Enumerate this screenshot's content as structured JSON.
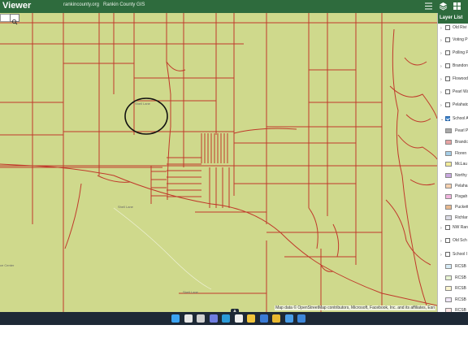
{
  "header": {
    "title": "Viewer",
    "links": [
      "rankincounty.org",
      "Rankin County GIS"
    ]
  },
  "map": {
    "attribution": "Map data © OpenStreetMap contributors, Microsoft, Facebook, Inc. and its affiliates, Esri",
    "road_labels": [
      "Shell Lane",
      "Shell Lane",
      "Shell Lane"
    ],
    "place_label": "ce Center",
    "base_color": "#cfd98c",
    "parcel_color": "#c0392b"
  },
  "layer_panel": {
    "title": "Layer List",
    "layers": [
      {
        "label": "Old Rivi",
        "checked": false
      },
      {
        "label": "Voting P",
        "checked": false
      },
      {
        "label": "Polling P",
        "checked": false
      },
      {
        "label": "Brandon",
        "checked": false
      },
      {
        "label": "Flowood",
        "checked": false
      },
      {
        "label": "Pearl Wa",
        "checked": false
      },
      {
        "label": "Pelahatc",
        "checked": false
      },
      {
        "label": "School A",
        "checked": true
      }
    ],
    "legend": [
      {
        "label": "Pearl P",
        "color": "#a9a9a9"
      },
      {
        "label": "Brandc",
        "color": "#e7a3a3"
      },
      {
        "label": "Floren",
        "color": "#a6cfe8"
      },
      {
        "label": "McLau",
        "color": "#f3ec9a"
      },
      {
        "label": "Northy",
        "color": "#c9a8e0"
      },
      {
        "label": "Pelaha",
        "color": "#f6d1b0"
      },
      {
        "label": "Pisgah",
        "color": "#f2b5df"
      },
      {
        "label": "Puckett",
        "color": "#e8b98f"
      },
      {
        "label": "Richlar",
        "color": "#dcdce6"
      }
    ],
    "more_layers": [
      {
        "label": "NW Ran",
        "checked": false
      },
      {
        "label": "Old Sch",
        "checked": false
      },
      {
        "label": "School I",
        "checked": false
      }
    ],
    "rcsb": [
      {
        "label": "RCSB",
        "color": "#d7ecf7"
      },
      {
        "label": "RCSB",
        "color": "#e8f5d4"
      },
      {
        "label": "RCSB",
        "color": "#fbf5cf"
      },
      {
        "label": "RCSB",
        "color": "#f0e6f7"
      },
      {
        "label": "RCSB",
        "color": "#fde4e4"
      }
    ]
  },
  "taskbar": {
    "icons": [
      {
        "name": "windows-start-icon",
        "color": "#3ba3f2"
      },
      {
        "name": "search-icon",
        "color": "#e7e7e7"
      },
      {
        "name": "task-view-icon",
        "color": "#d0d0d0"
      },
      {
        "name": "chat-icon",
        "color": "#6f7de0"
      },
      {
        "name": "edge-icon",
        "color": "#2b9ad8"
      },
      {
        "name": "photos-icon",
        "color": "#f0f0f0"
      },
      {
        "name": "file-explorer-icon",
        "color": "#f2c53c"
      },
      {
        "name": "store-icon",
        "color": "#3a7bd5"
      },
      {
        "name": "chrome-icon",
        "color": "#e8b830"
      },
      {
        "name": "settings-icon",
        "color": "#4a9ee8"
      },
      {
        "name": "app-icon",
        "color": "#3d86d9"
      }
    ]
  }
}
